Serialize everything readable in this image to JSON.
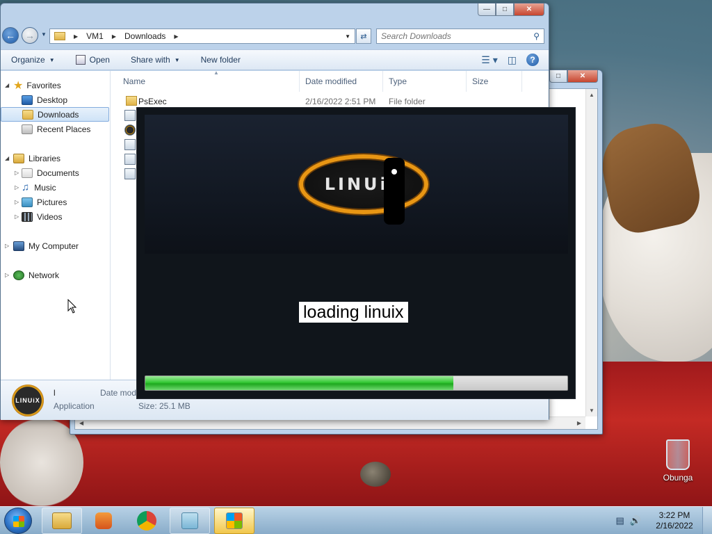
{
  "desktop": {
    "recycle_bin_label": "Obunga"
  },
  "explorer": {
    "address": {
      "crumbs": [
        "VM1",
        "Downloads"
      ]
    },
    "search": {
      "placeholder": "Search Downloads"
    },
    "command_bar": {
      "organize": "Organize",
      "open": "Open",
      "share_with": "Share with",
      "new_folder": "New folder"
    },
    "nav_pane": {
      "favorites": "Favorites",
      "desktop": "Desktop",
      "downloads": "Downloads",
      "recent_places": "Recent Places",
      "libraries": "Libraries",
      "documents": "Documents",
      "music": "Music",
      "pictures": "Pictures",
      "videos": "Videos",
      "my_computer": "My Computer",
      "network": "Network"
    },
    "columns": {
      "name": "Name",
      "date_modified": "Date modified",
      "type": "Type",
      "size": "Size"
    },
    "rows": [
      {
        "name": "PsExec",
        "date": "2/16/2022 2:51 PM",
        "type": "File folder"
      }
    ],
    "details": {
      "name": "l",
      "type": "Application",
      "date_label": "Date mod",
      "size": "Size: 25.1 MB",
      "logo_text": "LINUiX"
    }
  },
  "loader": {
    "logo_text": "LINUiX",
    "message": "loading linuix",
    "progress": 0.73
  },
  "taskbar": {
    "time": "3:22 PM",
    "date": "2/16/2022"
  }
}
